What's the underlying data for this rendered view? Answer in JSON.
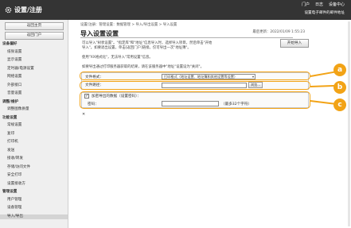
{
  "header": {
    "app_title": "设置/注册",
    "links": [
      "门户",
      "日志",
      "设备中心"
    ],
    "user_line": "登录用户：Administrator　注销",
    "user_sub": "设置电子邮件的邮件地址"
  },
  "sidebar": {
    "buttons": [
      "返回主页",
      "返回门户"
    ],
    "items": [
      {
        "label": "设备偏好",
        "kind": "cat"
      },
      {
        "label": "纸张设置",
        "kind": "sub"
      },
      {
        "label": "显示设置",
        "kind": "sub"
      },
      {
        "label": "定时器/电源设置",
        "kind": "sub"
      },
      {
        "label": "网络设置",
        "kind": "sub"
      },
      {
        "label": "外部接口",
        "kind": "sub"
      },
      {
        "label": "音量设置",
        "kind": "sub"
      },
      {
        "label": "调整/维护",
        "kind": "cat"
      },
      {
        "label": "调整图像质量",
        "kind": "sub"
      },
      {
        "label": "功能设置",
        "kind": "cat"
      },
      {
        "label": "常规设置",
        "kind": "sub"
      },
      {
        "label": "复印",
        "kind": "sub"
      },
      {
        "label": "打印机",
        "kind": "sub"
      },
      {
        "label": "发送",
        "kind": "sub"
      },
      {
        "label": "接收/转发",
        "kind": "sub"
      },
      {
        "label": "存储/访问文件",
        "kind": "sub"
      },
      {
        "label": "安全打印",
        "kind": "sub"
      },
      {
        "label": "设置接收方",
        "kind": "sub"
      },
      {
        "label": "管理设置",
        "kind": "cat"
      },
      {
        "label": "用户管理",
        "kind": "sub"
      },
      {
        "label": "设备管理",
        "kind": "sub"
      },
      {
        "label": "导入/导出",
        "kind": "active"
      }
    ]
  },
  "main": {
    "breadcrumb": "设置/注册：管理设置：数据管理 > 导入/导出设置 > 导入设置",
    "title": "导入设置设置",
    "updated": "最后更新：2022/01/09 1:55:23",
    "start_button": "开始导入",
    "description": [
      "可以导入\"树状设置\"。\"指定库\"和\"地址\"信息导入时，选择导入项目，然后单击\"开始",
      "导入\"。如要退出设置，单击[返回门户]链接。仅可导出一次\"地址簿\"。",
      "",
      "使用\"XX格式化\"，无法导入\"常用设置\"信息。",
      "",
      "如要导出通过打印服务器获取的结果，请在该服务器中\"地址\"设置设为\"关闭\"。"
    ],
    "form": {
      "format_label": "文件格式：",
      "format_value": "打印格式（地址设置、地址簿和其他设置等设置）",
      "path_label": "文件路径：",
      "browse_button": "浏览...",
      "encrypt_label": "加密导出的数据（设置密码）：",
      "encrypt_checked": true,
      "password_label": "密码：",
      "password_hint": "（最多32个字符）",
      "close_icon_text": "✕"
    }
  },
  "callouts": [
    "a",
    "b",
    "c"
  ],
  "colors": {
    "header": "#343434",
    "callout": "#f2a316"
  }
}
